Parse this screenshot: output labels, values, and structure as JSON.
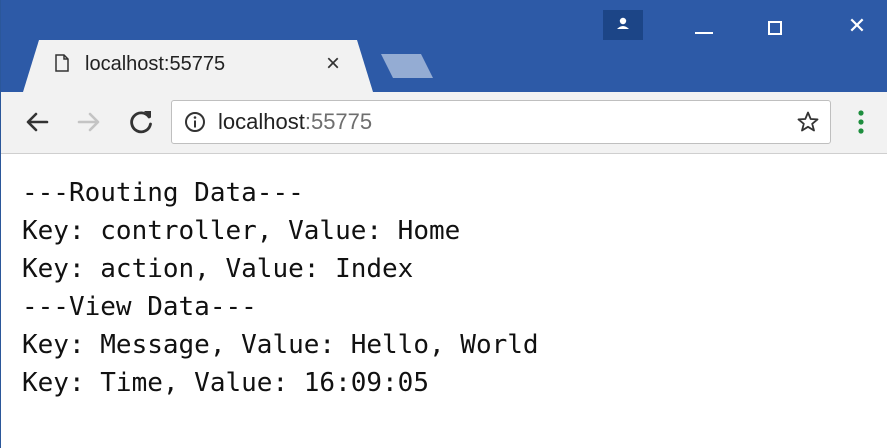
{
  "browser": {
    "tab": {
      "title": "localhost:55775",
      "close_label": "×"
    },
    "address_bar": {
      "host": "localhost",
      "port": ":55775"
    },
    "icons": {
      "page": "page-icon",
      "back": "back-arrow-icon",
      "forward": "forward-arrow-icon",
      "reload": "reload-icon",
      "info": "info-icon",
      "star": "bookmark-star-icon",
      "menu": "kebab-menu-icon",
      "profile": "profile-icon"
    },
    "window_controls": {
      "close_label": "✕"
    }
  },
  "page": {
    "lines": [
      "---Routing Data---",
      "Key: controller, Value: Home",
      "Key: action, Value: Index",
      "---View Data---",
      "Key: Message, Value: Hello, World",
      "Key: Time, Value: 16:09:05"
    ]
  },
  "colors": {
    "titlebar": "#2d5aa7",
    "tab_background": "#f2f2f2",
    "toolbar": "#f2f2f2",
    "menu_accent": "#1e8e3e"
  }
}
